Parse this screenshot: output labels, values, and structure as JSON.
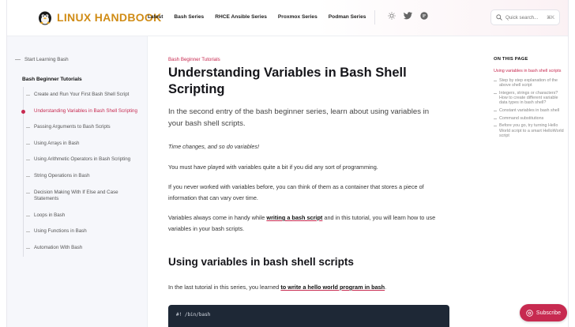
{
  "header": {
    "logo_text": "LINUX HANDBOOK",
    "nav": [
      "Latest",
      "Bash Series",
      "RHCE Ansible Series",
      "Proxmox Series",
      "Podman Series"
    ],
    "search_placeholder": "Quick search...",
    "search_shortcut": "⌘K",
    "icons": [
      "sun-icon",
      "twitter-icon",
      "ghost-icon"
    ]
  },
  "sidebar": {
    "top_link": "Start Learning Bash",
    "section_title": "Bash Beginner Tutorials",
    "items": [
      "Create and Run Your First Bash Shell Script",
      "Understanding Variables in Bash Shell Scripting",
      "Passing Arguments to Bash Scripts",
      "Using Arrays in Bash",
      "Using Arithmetic Operators in Bash Scripting",
      "String Operations in Bash",
      "Decision Making With If Else and Case Statements",
      "Loops in Bash",
      "Using Functions in Bash",
      "Automation With Bash"
    ],
    "active_index": 1
  },
  "article": {
    "breadcrumb": "Bash Beginner Tutorials",
    "title": "Understanding Variables in Bash Shell Scripting",
    "lead": "In the second entry of the bash beginner series, learn about using variables in your bash shell scripts.",
    "p1": "Time changes, and so do variables!",
    "p2": "You must have played with variables quite a bit if you did any sort of programming.",
    "p3": "If you never worked with variables before, you can think of them as a container that stores a piece of information that can vary over time.",
    "p4_before": "Variables always come in handy while ",
    "p4_link": "writing a bash script",
    "p4_after": " and in this tutorial, you will learn how to use variables in your bash scripts.",
    "h2": "Using variables in bash shell scripts",
    "p5_before": "In the last tutorial in this series, you learned ",
    "p5_link": "to write a hello world program in bash",
    "p5_after": ".",
    "code": "#! /bin/bash"
  },
  "toc": {
    "heading": "ON THIS PAGE",
    "first": "Using variables in bash shell scripts",
    "items": [
      "Step by step explanation of the above shell script",
      "Integers, strings or characters? How to create different variable data types in bash shell?",
      "Constant variables in bash shell",
      "Command substitutions",
      "Before you go, try turning Hello World script to a smart HelloWorld script"
    ]
  },
  "subscribe_label": "Subscribe",
  "colors": {
    "accent": "#c72a50",
    "logo": "#d08c16",
    "code_bg": "#1e2836"
  }
}
